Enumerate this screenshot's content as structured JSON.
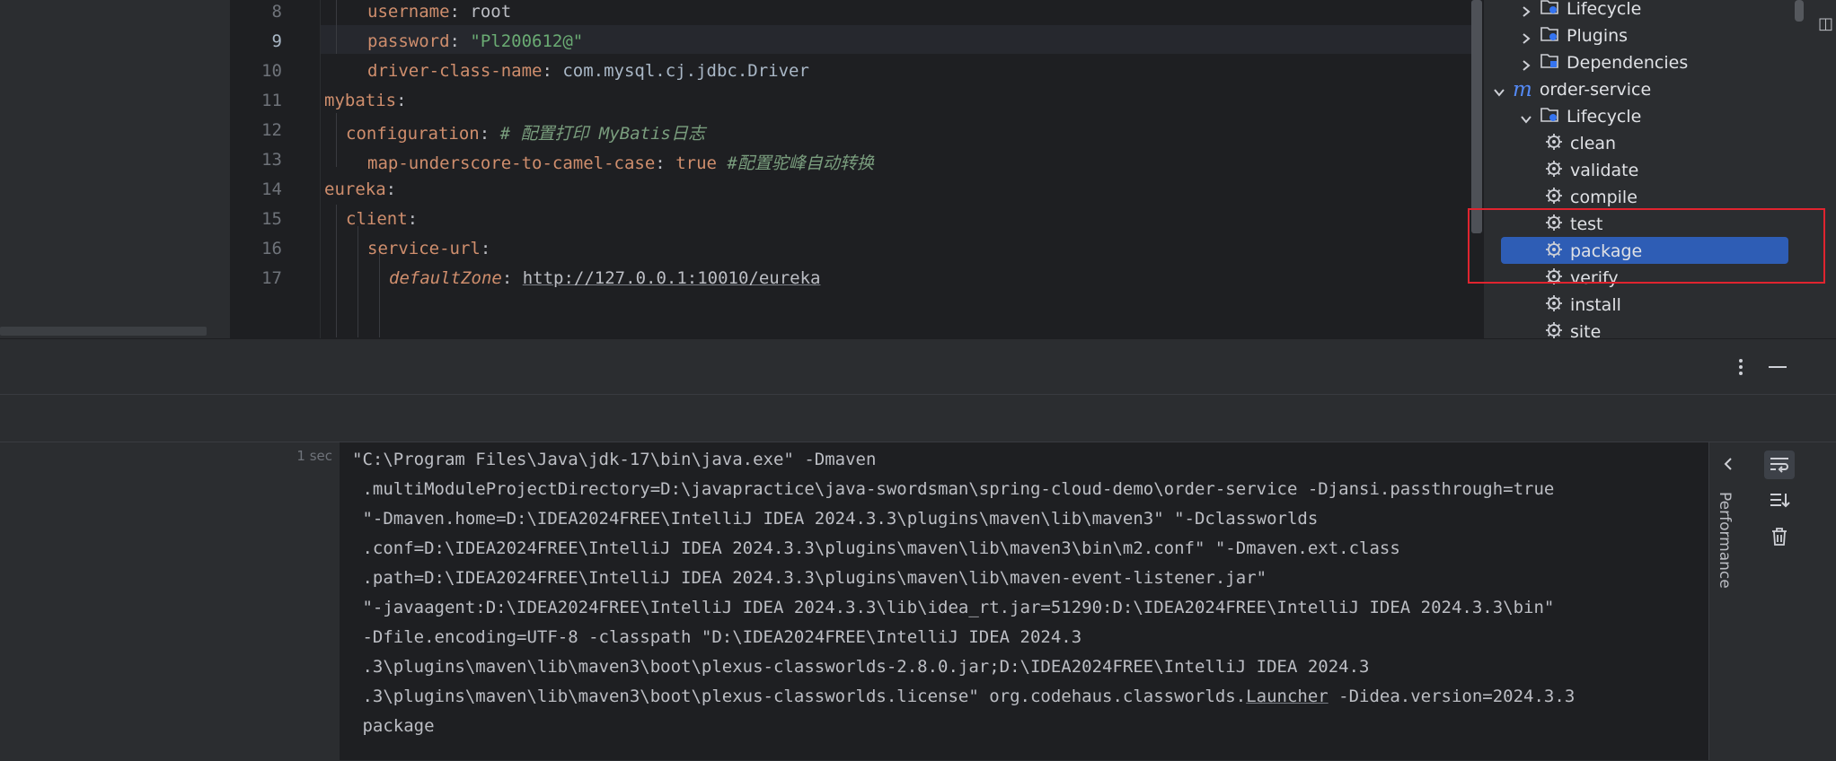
{
  "editor": {
    "lines": [
      {
        "num": "8",
        "parts": [
          {
            "t": "username",
            "c": "k"
          },
          {
            "t": ": ",
            "c": "v"
          },
          {
            "t": "root",
            "c": "v"
          }
        ]
      },
      {
        "num": "9",
        "parts": [
          {
            "t": "password",
            "c": "k"
          },
          {
            "t": ": ",
            "c": "v"
          },
          {
            "t": "\"Pl200612@\"",
            "c": "s"
          }
        ]
      },
      {
        "num": "10",
        "parts": [
          {
            "t": "driver-class-name",
            "c": "k"
          },
          {
            "t": ": ",
            "c": "v"
          },
          {
            "t": "com.mysql.cj.jdbc.Driver",
            "c": "pkg"
          }
        ]
      },
      {
        "num": "11",
        "parts": [
          {
            "t": "mybatis",
            "c": "k"
          },
          {
            "t": ":",
            "c": "v"
          }
        ]
      },
      {
        "num": "12",
        "parts": [
          {
            "t": "configuration",
            "c": "k"
          },
          {
            "t": ": ",
            "c": "v"
          },
          {
            "t": "# 配置打印 MyBatis日志",
            "c": "c"
          }
        ]
      },
      {
        "num": "13",
        "parts": [
          {
            "t": "map-underscore-to-camel-case",
            "c": "k"
          },
          {
            "t": ": ",
            "c": "v"
          },
          {
            "t": "true",
            "c": "kw"
          },
          {
            "t": " ",
            "c": "v"
          },
          {
            "t": "#配置驼峰自动转换",
            "c": "c"
          }
        ]
      },
      {
        "num": "14",
        "parts": [
          {
            "t": "eureka",
            "c": "k"
          },
          {
            "t": ":",
            "c": "v"
          }
        ]
      },
      {
        "num": "15",
        "parts": [
          {
            "t": "client",
            "c": "k"
          },
          {
            "t": ":",
            "c": "v"
          }
        ]
      },
      {
        "num": "16",
        "parts": [
          {
            "t": "service-url",
            "c": "k"
          },
          {
            "t": ":",
            "c": "v"
          }
        ]
      },
      {
        "num": "17",
        "parts": [
          {
            "t": "defaultZone",
            "c": "ital"
          },
          {
            "t": ": ",
            "c": "v"
          },
          {
            "t": "http://127.0.0.1:10010/eureka",
            "c": "url"
          }
        ]
      }
    ]
  },
  "maven_tree": {
    "items": [
      {
        "label": "Lifecycle"
      },
      {
        "label": "Plugins"
      },
      {
        "label": "Dependencies"
      },
      {
        "label": "order-service"
      },
      {
        "label": "Lifecycle"
      },
      {
        "label": "clean"
      },
      {
        "label": "validate"
      },
      {
        "label": "compile"
      },
      {
        "label": "test"
      },
      {
        "label": "package"
      },
      {
        "label": "verify"
      },
      {
        "label": "install"
      },
      {
        "label": "site"
      }
    ]
  },
  "run": {
    "elapsed": "1 sec",
    "output_lines": [
      "\"C:\\Program Files\\Java\\jdk-17\\bin\\java.exe\" -Dmaven",
      " .multiModuleProjectDirectory=D:\\javapractice\\java-swordsman\\spring-cloud-demo\\order-service -Djansi.passthrough=true",
      " \"-Dmaven.home=D:\\IDEA2024FREE\\IntelliJ IDEA 2024.3.3\\plugins\\maven\\lib\\maven3\" \"-Dclassworlds",
      " .conf=D:\\IDEA2024FREE\\IntelliJ IDEA 2024.3.3\\plugins\\maven\\lib\\maven3\\bin\\m2.conf\" \"-Dmaven.ext.class",
      " .path=D:\\IDEA2024FREE\\IntelliJ IDEA 2024.3.3\\plugins\\maven\\lib\\maven-event-listener.jar\"",
      " \"-javaagent:D:\\IDEA2024FREE\\IntelliJ IDEA 2024.3.3\\lib\\idea_rt.jar=51290:D:\\IDEA2024FREE\\IntelliJ IDEA 2024.3.3\\bin\"",
      " -Dfile.encoding=UTF-8 -classpath \"D:\\IDEA2024FREE\\IntelliJ IDEA 2024.3",
      " .3\\plugins\\maven\\lib\\maven3\\boot\\plexus-classworlds-2.8.0.jar;D:\\IDEA2024FREE\\IntelliJ IDEA 2024.3",
      " .3\\plugins\\maven\\lib\\maven3\\boot\\plexus-classworlds.license\" org.codehaus.classworlds.",
      " package"
    ],
    "launcher_word": "Launcher",
    "launcher_tail": " -Didea.version=2024.3.3",
    "side_label": "Performance"
  },
  "colors": {
    "selection": "#2e5db5",
    "annotation_box": "#e0242f"
  }
}
